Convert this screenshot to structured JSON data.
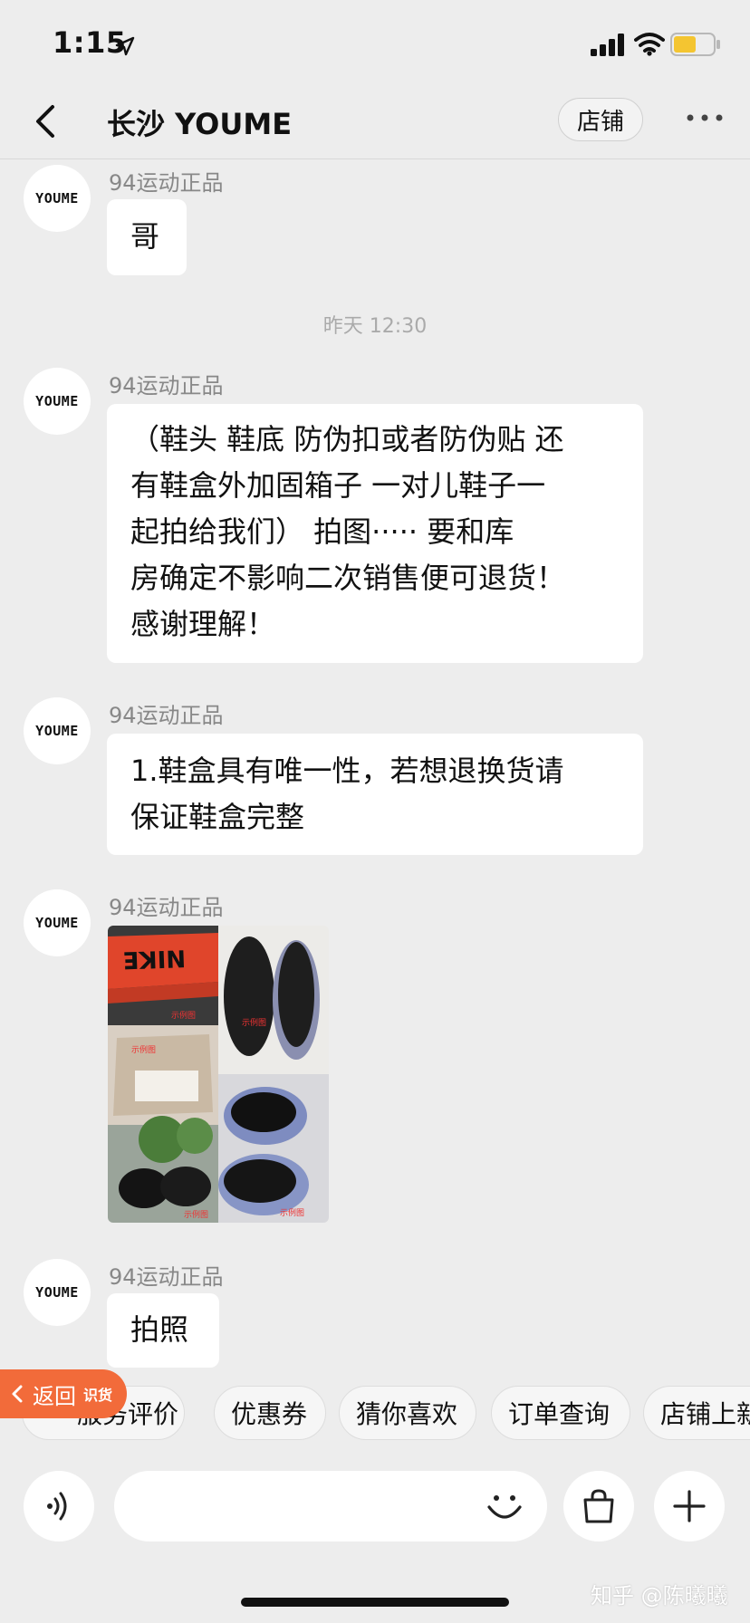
{
  "status_bar": {
    "time": "1:15"
  },
  "nav": {
    "title": "长沙 YOUME",
    "shop_button": "店铺"
  },
  "avatar_text": "YOUME",
  "messages": [
    {
      "sender": "94运动正品",
      "text": "哥"
    },
    {
      "sender": "94运动正品",
      "lines": [
        "（鞋头 鞋底 防伪扣或者防伪贴 还",
        "有鞋盒外加固箱子 一对儿鞋子一",
        "起拍给我们） 拍图·····  要和库",
        "房确定不影响二次销售便可退货！",
        "感谢理解！"
      ]
    },
    {
      "sender": "94运动正品",
      "lines": [
        "1.鞋盒具有唯一性，若想退换货请",
        "保证鞋盒完整"
      ]
    },
    {
      "sender": "94运动正品",
      "image": "photo-collage"
    },
    {
      "sender": "94运动正品",
      "text": "拍照"
    }
  ],
  "timestamp": "昨天 12:30",
  "photo_labels": {
    "brand": "NIKE",
    "sample": "示例图"
  },
  "quick_replies": [
    "服务评价",
    "优惠券",
    "猜你喜欢",
    "订单查询",
    "店铺上新"
  ],
  "back_pill": {
    "label": "返回",
    "tag": "识货"
  },
  "input": {
    "value": "",
    "placeholder": ""
  },
  "watermark": "知乎 @陈曦曦",
  "colors": {
    "background": "#ededed",
    "bubble": "#ffffff",
    "back_pill": "#f26b3a"
  }
}
